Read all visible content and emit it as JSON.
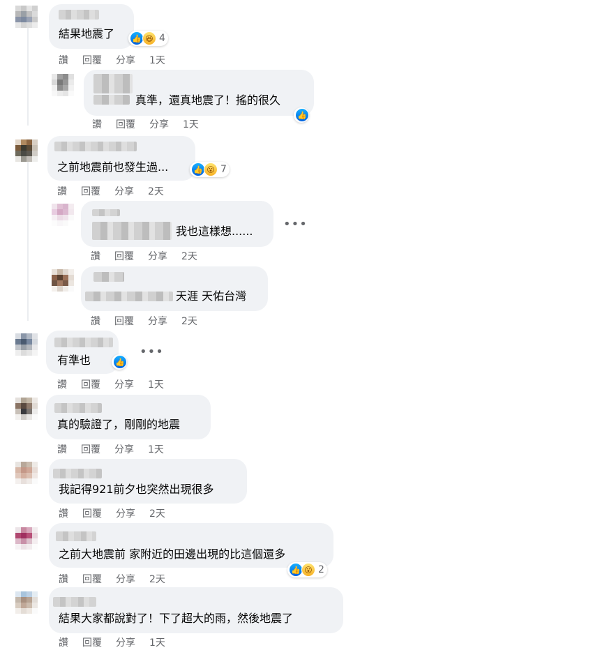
{
  "actions": {
    "like": "讚",
    "reply": "回覆",
    "share": "分享"
  },
  "comments": [
    {
      "text": "結果地震了",
      "time": "1天",
      "reaction_count": "4",
      "reactions": [
        "like-icon",
        "haha-icon"
      ]
    },
    {
      "text": "真準，還真地震了！搖的很久",
      "time": "1天",
      "reactions": [
        "like-icon"
      ]
    },
    {
      "text": "之前地震前也發生過...",
      "time": "2天",
      "reaction_count": "7",
      "reactions": [
        "like-icon",
        "wow-icon"
      ]
    },
    {
      "text": "我也這樣想......",
      "time": "2天"
    },
    {
      "text": "天涯 天佑台灣",
      "time": "2天"
    },
    {
      "text": "有準也",
      "time": "1天",
      "reactions": [
        "like-icon"
      ]
    },
    {
      "text": "真的驗證了，剛剛的地震",
      "time": "1天"
    },
    {
      "text": "我記得921前夕也突然出現很多",
      "time": "2天"
    },
    {
      "text": "之前大地震前 家附近的田邊出現的比這個還多",
      "time": "2天",
      "reaction_count": "2",
      "reactions": [
        "like-icon",
        "wow-icon"
      ]
    },
    {
      "text": "結果大家都說對了！下了超大的雨，然後地震了",
      "time": "1天"
    }
  ],
  "icons": {
    "more": "more-options-icon",
    "like": "like-icon",
    "haha": "haha-icon",
    "wow": "wow-icon"
  },
  "colors": {
    "bubble": "#f0f2f5",
    "meta_text": "#65676b",
    "like_blue": "#1877f2"
  }
}
